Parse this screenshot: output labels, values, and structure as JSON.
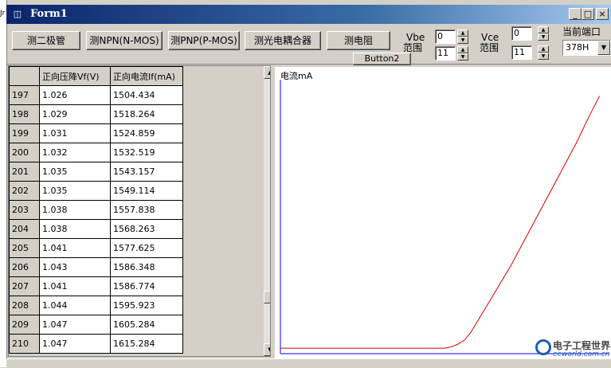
{
  "edge_text": "Jr",
  "window": {
    "title": "Form1",
    "icon": "app-icon",
    "minimize_glyph": "_",
    "maximize_glyph": "□",
    "close_glyph": "×"
  },
  "toolbar": {
    "diode_button": "测二极管",
    "npn_button": "测NPN(N-MOS)",
    "pnp_button": "测PNP(P-MOS)",
    "optocoupler_button": "测光电耦合器",
    "resistor_button": "测电阻",
    "button2": "Button2",
    "vbe_label": "Vbe",
    "vbe_range_label": "范围",
    "vbe_min": "0",
    "vbe_max": "11",
    "vce_label": "Vce",
    "vce_range_label": "范围",
    "vce_min": "0",
    "vce_max": "11",
    "port_label": "当前端口",
    "port_value": "378H"
  },
  "table": {
    "columns": [
      "",
      "正向压降Vf(V)",
      "正向电流If(mA)"
    ],
    "rows": [
      [
        "197",
        "1.026",
        "1504.434"
      ],
      [
        "198",
        "1.029",
        "1518.264"
      ],
      [
        "199",
        "1.031",
        "1524.859"
      ],
      [
        "200",
        "1.032",
        "1532.519"
      ],
      [
        "201",
        "1.035",
        "1543.157"
      ],
      [
        "202",
        "1.035",
        "1549.114"
      ],
      [
        "203",
        "1.038",
        "1557.838"
      ],
      [
        "204",
        "1.038",
        "1568.263"
      ],
      [
        "205",
        "1.041",
        "1577.625"
      ],
      [
        "206",
        "1.043",
        "1586.348"
      ],
      [
        "207",
        "1.041",
        "1586.774"
      ],
      [
        "208",
        "1.044",
        "1595.923"
      ],
      [
        "209",
        "1.047",
        "1605.284"
      ],
      [
        "210",
        "1.047",
        "1615.284"
      ]
    ]
  },
  "chart": {
    "ylabel": "电流mA",
    "axis_color": "#0000ff",
    "curve_color": "#d00000"
  },
  "chart_data": {
    "type": "line",
    "ylabel": "电流mA",
    "xlabel": "",
    "grid": false,
    "xlim": [
      0,
      1
    ],
    "ylim": [
      0,
      1
    ],
    "series": [
      {
        "x": [
          0,
          0.2,
          0.4,
          0.5,
          0.52,
          0.54,
          0.56,
          0.58,
          0.6,
          0.63,
          0.66,
          0.7,
          0.74,
          0.78,
          0.82,
          0.86,
          0.9,
          0.94,
          0.97
        ],
        "y": [
          0.02,
          0.02,
          0.02,
          0.02,
          0.025,
          0.035,
          0.05,
          0.08,
          0.12,
          0.18,
          0.24,
          0.32,
          0.41,
          0.5,
          0.59,
          0.68,
          0.77,
          0.87,
          0.94
        ]
      }
    ]
  },
  "watermark": {
    "title": "电子工程世界",
    "url": "eeworld.com.cn"
  }
}
